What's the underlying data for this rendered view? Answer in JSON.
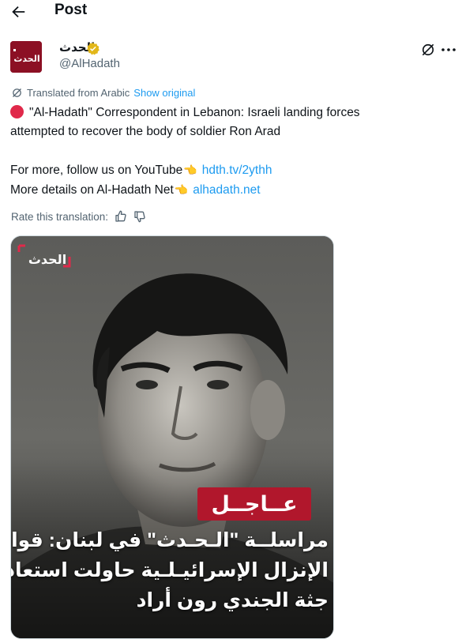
{
  "header": {
    "title": "Post"
  },
  "author": {
    "name": "الحدث",
    "handle": "@AlHadath",
    "avatar_label": "الحدث",
    "verified_color": "#e2b719"
  },
  "translation": {
    "label": "Translated from Arabic",
    "show_original": "Show original",
    "rate_label": "Rate this translation:"
  },
  "tweet": {
    "line1": "\"Al-Hadath\" Correspondent in Lebanon: Israeli landing forces",
    "line2": "attempted to recover the body of soldier Ron Arad",
    "youtube_text": "For more, follow us on YouTube",
    "youtube_link": "hdth.tv/2ythh",
    "net_text": "More details on Al-Hadath Net",
    "net_link": "alhadath.net",
    "pointing_emoji": "👈"
  },
  "media": {
    "watermark": "الحدث",
    "badge": "عــاجــل",
    "caption_lines": [
      "مراسلــة \"الـحـدث\" في لبنان: قوات",
      "الإنزال الإسرائيـلـية حاولت استعادة",
      "جثة الجندي رون أراد"
    ]
  },
  "colors": {
    "link": "#1d9bf0",
    "secondary_text": "#536471",
    "badge_red": "#b1172c"
  }
}
